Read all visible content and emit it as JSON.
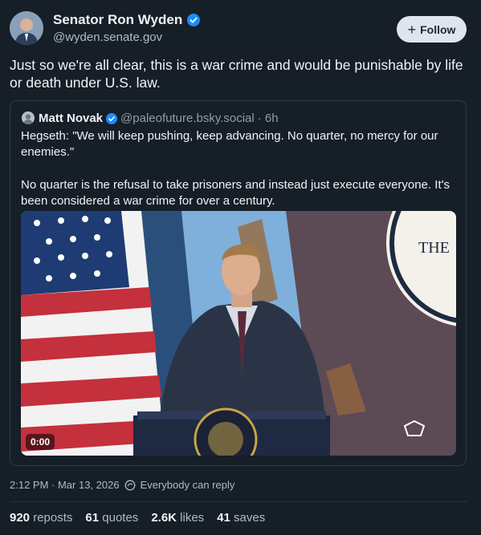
{
  "author": {
    "name": "Senator Ron Wyden",
    "handle": "@wyden.senate.gov",
    "verified": true,
    "follow_label": "Follow"
  },
  "post": {
    "text": "Just so we're all clear, this is a war crime and would be punishable by life or death under U.S. law."
  },
  "quote": {
    "name": "Matt Novak",
    "handle": "@paleofuture.bsky.social",
    "time": "· 6h",
    "text1": "Hegseth: \"We will keep pushing, keep advancing. No quarter, no mercy for our enemies.\"",
    "text2": "No quarter is the refusal to take prisoners and instead just execute everyone. It's been considered a war crime for over a century.",
    "video_time": "0:00",
    "video_sign_text": "THE"
  },
  "meta": {
    "timestamp": "2:12 PM · Mar 13, 2026",
    "reply_setting": "Everybody can reply"
  },
  "stats": {
    "reposts_count": "920",
    "reposts_label": "reposts",
    "quotes_count": "61",
    "quotes_label": "quotes",
    "likes_count": "2.6K",
    "likes_label": "likes",
    "saves_count": "41",
    "saves_label": "saves"
  },
  "colors": {
    "background": "#161e27",
    "verified_blue": "#1a8cff",
    "muted_text": "#aebbc9"
  }
}
